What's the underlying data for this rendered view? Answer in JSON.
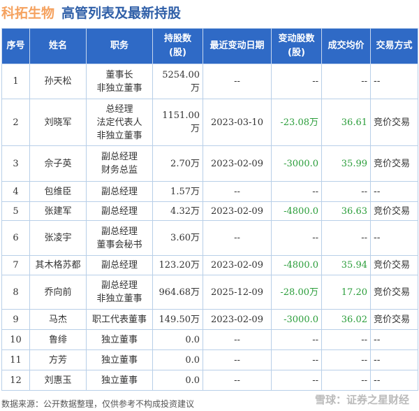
{
  "title": {
    "company": "科拓生物",
    "subtitle": "高管列表及最新持股"
  },
  "columns": [
    "序号",
    "姓名",
    "职务",
    "持股数\n(股)",
    "最近变动日期",
    "变动股数\n(股)",
    "成交均价",
    "交易方式"
  ],
  "rows": [
    {
      "no": "1",
      "name": "孙天松",
      "role": [
        "董事长",
        "非独立董事"
      ],
      "shares": "5254.00万",
      "date": "--",
      "change": "--",
      "price": "--",
      "method": "--"
    },
    {
      "no": "2",
      "name": "刘晓军",
      "role": [
        "总经理",
        "法定代表人",
        "非独立董事"
      ],
      "shares": "1151.00万",
      "date": "2023-03-10",
      "change": "-23.08万",
      "price": "36.61",
      "method": "竞价交易"
    },
    {
      "no": "3",
      "name": "佘子英",
      "role": [
        "副总经理",
        "财务总监"
      ],
      "shares": "2.70万",
      "date": "2023-02-09",
      "change": "-3000.0",
      "price": "35.99",
      "method": "竞价交易"
    },
    {
      "no": "4",
      "name": "包维臣",
      "role": [
        "副总经理"
      ],
      "shares": "1.57万",
      "date": "--",
      "change": "--",
      "price": "--",
      "method": "--"
    },
    {
      "no": "5",
      "name": "张建军",
      "role": [
        "副总经理"
      ],
      "shares": "4.32万",
      "date": "2023-02-09",
      "change": "-4800.0",
      "price": "36.63",
      "method": "竞价交易"
    },
    {
      "no": "6",
      "name": "张凌宇",
      "role": [
        "副总经理",
        "董事会秘书"
      ],
      "shares": "3.60万",
      "date": "--",
      "change": "--",
      "price": "--",
      "method": "--"
    },
    {
      "no": "7",
      "name": "其木格苏都",
      "role": [
        "副总经理"
      ],
      "shares": "123.20万",
      "date": "2023-02-09",
      "change": "-4800.0",
      "price": "35.94",
      "method": "竞价交易"
    },
    {
      "no": "8",
      "name": "乔向前",
      "role": [
        "副总经理",
        "非独立董事"
      ],
      "shares": "964.68万",
      "date": "2025-12-09",
      "change": "-28.00万",
      "price": "17.20",
      "method": "竞价交易"
    },
    {
      "no": "9",
      "name": "马杰",
      "role": [
        "职工代表董事"
      ],
      "shares": "149.50万",
      "date": "2023-02-09",
      "change": "-3000.0",
      "price": "36.02",
      "method": "竞价交易"
    },
    {
      "no": "10",
      "name": "鲁绯",
      "role": [
        "独立董事"
      ],
      "shares": "0.0",
      "date": "--",
      "change": "--",
      "price": "--",
      "method": "--"
    },
    {
      "no": "11",
      "name": "方芳",
      "role": [
        "独立董事"
      ],
      "shares": "0.0",
      "date": "--",
      "change": "--",
      "price": "--",
      "method": "--"
    },
    {
      "no": "12",
      "name": "刘惠玉",
      "role": [
        "独立董事"
      ],
      "shares": "0.0",
      "date": "--",
      "change": "--",
      "price": "--",
      "method": "--"
    }
  ],
  "footer": "数据来源：公开数据整理，仅供参考不构成投资建议",
  "watermark": "雪球：证券之星财经",
  "colors": {
    "header": "#2f6ac6",
    "company": "#f5a25f",
    "title": "#2f5fa8",
    "negative": "#2a9d3a"
  }
}
